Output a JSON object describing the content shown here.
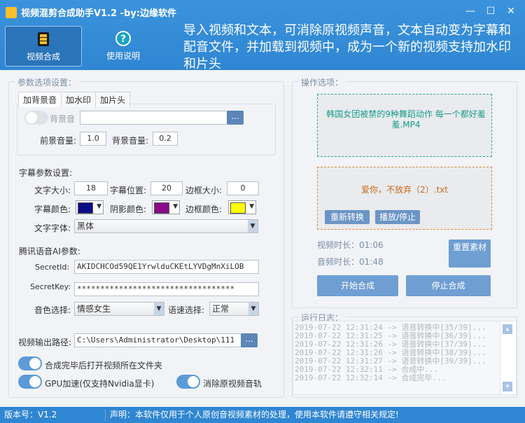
{
  "window": {
    "title": "视频混剪合成助手V1.2 -by:边缘软件"
  },
  "nav": [
    {
      "label": "视频合成",
      "icon": "film-icon"
    },
    {
      "label": "使用说明",
      "icon": "help-icon"
    }
  ],
  "notice": "导入视频和文本，可消除原视频声音，文本自动变为字幕和配音文件，并加载到视频中，成为一个新的视频支持加水印和片头",
  "params": {
    "legend": "参数选项设置：",
    "tabs": [
      "加背景音",
      "加水印",
      "加片头"
    ],
    "bg_music_label": "背景音",
    "bg_music_path": "",
    "browse": "...",
    "fg_volume_label": "前景音量:",
    "fg_volume": "1.0",
    "bg_volume_label": "背景音量:",
    "bg_volume": "0.2"
  },
  "subtitle": {
    "heading": "字幕参数设置:",
    "size_label": "文字大小:",
    "size": "18",
    "pos_label": "字幕位置:",
    "pos": "20",
    "border_label": "边框大小:",
    "border": "0",
    "color_label": "字幕颜色:",
    "color": "#0d0d8a",
    "shadow_label": "阴影颜色:",
    "shadow_color": "#8a0a8a",
    "border_color_label": "边框颜色:",
    "border_color": "#ffff00",
    "font_label": "文字字体:",
    "font": "黑体"
  },
  "tts": {
    "heading": "腾讯语音AI参数:",
    "secret_id_label": "SecretId:",
    "secret_id": "AKIDCHCOd59QE1YrwlduCKEtLYVDgMnXiLOB",
    "secret_key_label": "SecretKey:",
    "secret_key": "**********************************",
    "voice_label": "音色选择:",
    "voice": "情感女生",
    "speed_label": "语速选择:",
    "speed": "正常"
  },
  "output": {
    "label": "视频输出路径:",
    "path": "C:\\Users\\Administrator\\Desktop\\111",
    "browse": "..."
  },
  "options": {
    "open_folder": "合成完毕后打开视频所在文件夹",
    "gpu": "GPU加速(仅支持Nvidia显卡)",
    "mute": "消除原视频音轨"
  },
  "ops": {
    "legend": "操作选项：",
    "video_file": "韩国女团被禁的9种舞蹈动作 每一个都好羞羞.MP4",
    "text_file": "爱你，不放弃（2）.txt",
    "reconvert": "重新转换",
    "play_stop": "播放/停止",
    "video_duration": "视频时长：01:06",
    "audio_duration": "音频时长：01:48",
    "reset": "重置素材",
    "start": "开始合成",
    "stop": "停止合成"
  },
  "log": {
    "legend": "运行日志：",
    "lines": [
      "2019-07-22 12:31:24 -> 语音转换中[35/39]...",
      "2019-07-22 12:31:25 -> 语音转换中[36/39]...",
      "2019-07-22 12:31:26 -> 语音转换中[37/39]...",
      "2019-07-22 12:31:26 -> 语音转换中[38/39]...",
      "2019-07-22 12:31:27 -> 语音转换中[39/39]...",
      "2019-07-22 12:32:11 -> 合成中...",
      "2019-07-22 12:32:14 -> 合成完毕..."
    ]
  },
  "status": {
    "version": "版本号：V1.2",
    "disclaimer": "声明：本软件仅用于个人原创音视频素材的处理，使用本软件请遵守相关规定!"
  },
  "colors": {
    "primary": "#2f86d2",
    "button": "#6f9ed2"
  }
}
